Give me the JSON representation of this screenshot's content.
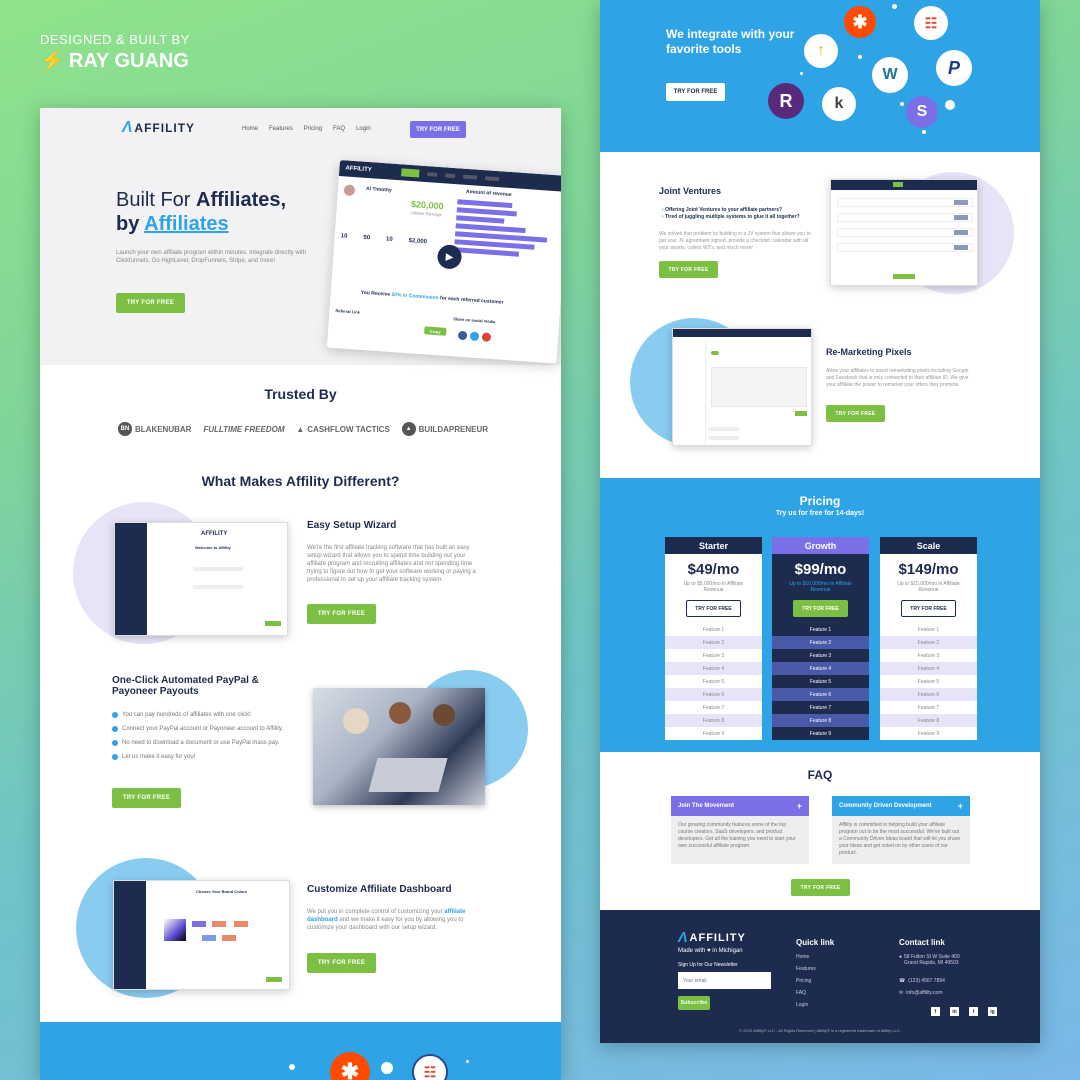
{
  "credit": {
    "line1": "DESIGNED & BUILT BY",
    "line2": "RAY GUANG"
  },
  "brand": {
    "logo": "AFFILITY",
    "accent": "#2ea3e6",
    "green": "#7bc043",
    "purple": "#7b6fe8",
    "navy": "#1d2b4f"
  },
  "nav": {
    "links": [
      "Home",
      "Features",
      "Pricing",
      "FAQ",
      "Login"
    ],
    "cta": "TRY FOR FREE"
  },
  "hero": {
    "title_prefix": "Built For ",
    "title_bold": "Affiliates,",
    "title_by": "by ",
    "title_link": "Affiliates",
    "description": "Launch your own affiliate program within minutes. Integrate directly with Clickfunnels, Go HighLevel, DropFunnels, Stripe, and more!",
    "cta": "TRY FOR FREE",
    "dash": {
      "user": "Al Timothy",
      "earnings": "$20,000",
      "earnings_label": "Lifetime Earnings",
      "stats": [
        "10",
        "50",
        "10",
        "$2,000"
      ],
      "chart_title": "Amount of revenue",
      "commission_pre": "You Receive ",
      "commission_pct": "50% in Commission",
      "commission_post": " for each referred customer",
      "referral_label": "Referral Link",
      "share_label": "Share on social media",
      "copy": "Copy"
    }
  },
  "trusted": {
    "title": "Trusted By",
    "logos": [
      "BLAKENUBAR",
      "FULLTIME FREEDOM",
      "CASHFLOW TACTICS",
      "BUILDAPRENEUR"
    ]
  },
  "different": {
    "title": "What Makes Affility Different?"
  },
  "wizard": {
    "title": "Easy Setup Wizard",
    "text": "We're the first affiliate tracking software that has built an easy setup wizard that allows you to spend time building out your affiliate program and recruiting affiliates and not spending time trying to figure out how to get your software working or paying a professional to set up your affiliate tracking system.",
    "cta": "TRY FOR FREE",
    "mock_title": "Welcome to Affility"
  },
  "payouts": {
    "title": "One-Click Automated PayPal & Payoneer Payouts",
    "items": [
      "You can pay hundreds of affiliates with one click!",
      "Connect your PayPal account or Payoneer account to Affility.",
      "No need to download a document or use PayPal mass pay.",
      "Let us make it easy for you!"
    ],
    "cta": "TRY FOR FREE"
  },
  "customize": {
    "title": "Customize Affiliate Dashboard",
    "text_pre": "We put you in complete control of customizing your ",
    "text_link": "affiliate dashboard",
    "text_post": " and we make it easy for you by allowing you to customize your dashboard with our setup wizard.",
    "cta": "TRY FOR FREE",
    "mock_title": "Choose Your Brand Colors"
  },
  "integrate": {
    "title": "We integrate with your favorite tools",
    "cta": "TRY FOR FREE"
  },
  "joint": {
    "title": "Joint Ventures",
    "bullets": [
      "Offering Joint Ventures to your affiliate partners?",
      "Tired of juggling multiple systems to glue it all together?"
    ],
    "text": "We solved that problem by building in a JV system that allows you to get your JV agreement signed, provide a checklist, calendar with all your assets, collect W2's, and much more!",
    "cta": "TRY FOR FREE"
  },
  "remarketing": {
    "title": "Re-Marketing Pixels",
    "text": "Allow your affiliates to insert remarketing pixels including Google and Facebook that is only connected to their affiliate ID. We give your affiliate the power to remarket your offers they promote.",
    "cta": "TRY FOR FREE"
  },
  "pricing": {
    "title": "Pricing",
    "subtitle": "Try us for free for 14-days!",
    "plans": [
      {
        "name": "Starter",
        "price": "$49/mo",
        "limit": "Up to $5,000/mo in Affiliate Revenue",
        "cta": "TRY FOR FREE"
      },
      {
        "name": "Growth",
        "price": "$99/mo",
        "limit": "Up to $10,000/mo in Affiliate Revenue",
        "cta": "TRY FOR FREE"
      },
      {
        "name": "Scale",
        "price": "$149/mo",
        "limit": "Up to $15,000/mo in Affiliate Revenue",
        "cta": "TRY FOR FREE"
      }
    ],
    "features": [
      "Feature 1",
      "Feature 2",
      "Feature 3",
      "Feature 4",
      "Feature 5",
      "Feature 6",
      "Feature 7",
      "Feature 8",
      "Feature 9"
    ]
  },
  "faq": {
    "title": "FAQ",
    "items": [
      {
        "q": "Join The Movement",
        "a": "Our growing community features some of the top course creators, SaaS developers, and product developers. Get all the training you need to start your own successful affiliate program."
      },
      {
        "q": "Community Driven Development",
        "a": "Affility is committed to helping build your affiliate program out to be the most successful. We've built out a Community Driven Ideas board that will let you share your ideas and get voted on by other users of our product."
      }
    ],
    "cta": "TRY FOR FREE"
  },
  "footer": {
    "made": "Made with ♥ in Michigan",
    "signup": "Sign Up for Our Newsletter",
    "email_placeholder": "Your email",
    "subscribe": "Subscribe",
    "quick_title": "Quick link",
    "quick": [
      "Home",
      "Features",
      "Pricing",
      "FAQ",
      "Login"
    ],
    "contact_title": "Contact link",
    "address": "58 Fulton St W Suite 400 Grand Rapids, MI 49503",
    "phone": "(123) 4567 7894",
    "email": "info@affility.com",
    "social": [
      "f",
      "in",
      "t",
      "ig"
    ],
    "copyright": "© 2020 Affility® LLC - All Rights Reserved | Affility® is a registered trademark of Affility LLC."
  }
}
